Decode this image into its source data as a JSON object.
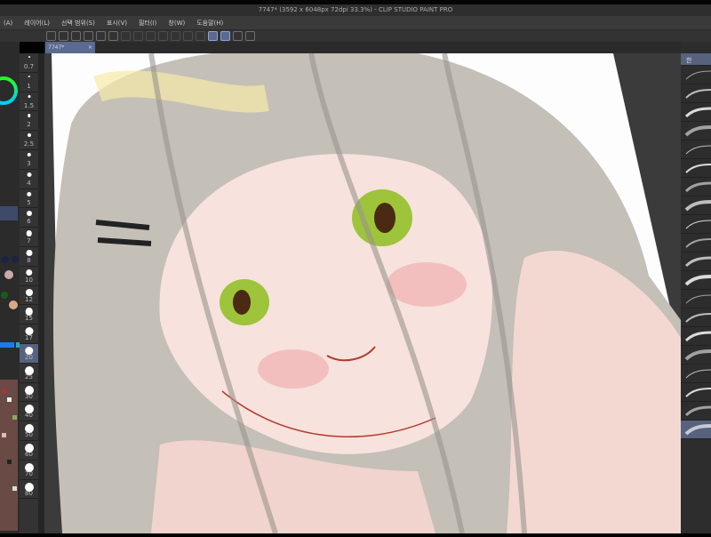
{
  "window": {
    "title": "7747* (3592 x 6048px 72dpi 33.3%) - CLIP STUDIO PAINT PRO"
  },
  "menu": [
    "(A)",
    "레이어(L)",
    "선택 범위(S)",
    "표시(V)",
    "필터(I)",
    "창(W)",
    "도움말(H)"
  ],
  "tab": {
    "label": "7747*",
    "close": "×"
  },
  "brush_sizes": [
    "0.7",
    "1",
    "1.5",
    "2",
    "2.5",
    "3",
    "4",
    "5",
    "6",
    "7",
    "8",
    "10",
    "12",
    "15",
    "17",
    "20",
    "25",
    "30",
    "40",
    "50",
    "60",
    "70",
    "80"
  ],
  "selected_brush_size": "20",
  "right_panel": {
    "header": "한",
    "brush_count": 20
  },
  "colors": {
    "accent": "#56627e",
    "skin": "#f4dcd6",
    "hair": "#bdb8b0",
    "eye": "#8fbf2a",
    "line": "#b23a2a"
  }
}
